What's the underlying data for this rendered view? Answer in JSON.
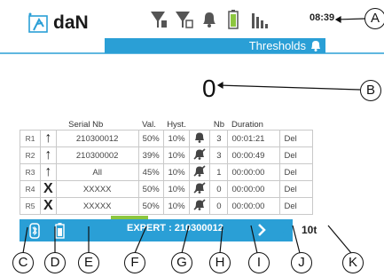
{
  "header": {
    "brand": "daN",
    "time": "08:39"
  },
  "thresholds_title": "Thresholds",
  "big_value": "0",
  "table": {
    "columns": [
      "",
      "",
      "Serial Nb",
      "Val.",
      "Hyst.",
      "",
      "Nb",
      "Duration",
      ""
    ],
    "rows": [
      {
        "id": "R1",
        "direction": "↑",
        "serial": "210300012",
        "val": "50%",
        "hyst": "10%",
        "alarm": "bell",
        "nb": "3",
        "duration": "00:01:21",
        "action": "Del"
      },
      {
        "id": "R2",
        "direction": "↑",
        "serial": "210300002",
        "val": "39%",
        "hyst": "10%",
        "alarm": "bell-off",
        "nb": "3",
        "duration": "00:00:49",
        "action": "Del"
      },
      {
        "id": "R3",
        "direction": "↑",
        "serial": "All",
        "val": "45%",
        "hyst": "10%",
        "alarm": "bell-off",
        "nb": "1",
        "duration": "00:00:00",
        "action": "Del"
      },
      {
        "id": "R4",
        "direction": "X",
        "serial": "XXXXX",
        "val": "50%",
        "hyst": "10%",
        "alarm": "bell-off",
        "nb": "0",
        "duration": "00:00:00",
        "action": "Del"
      },
      {
        "id": "R5",
        "direction": "X",
        "serial": "XXXXX",
        "val": "50%",
        "hyst": "10%",
        "alarm": "bell-off",
        "nb": "0",
        "duration": "00:00:00",
        "action": "Del"
      }
    ]
  },
  "footer": {
    "expert_label": "EXPERT : 210300012",
    "right_text": "10t"
  },
  "callouts": [
    "A",
    "B",
    "C",
    "D",
    "E",
    "F",
    "G",
    "H",
    "I",
    "J",
    "K"
  ],
  "colors": {
    "accent": "#2a9fd6",
    "green": "#8cc63f"
  }
}
